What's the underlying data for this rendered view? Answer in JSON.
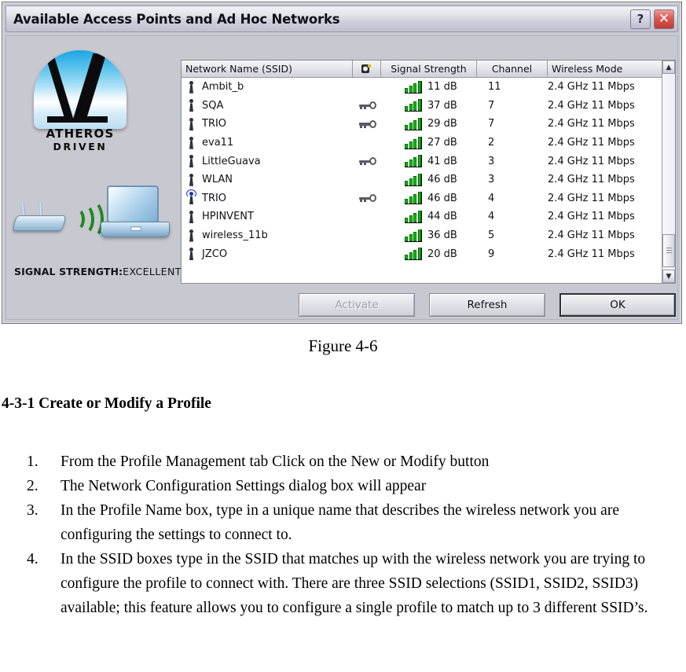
{
  "dialog": {
    "title": "Available Access Points and Ad Hoc Networks",
    "help_button": "?",
    "close_button": "✕"
  },
  "brand": {
    "logo_name": "Atheros",
    "wordmark": "ATHEROS",
    "sub_wordmark": "DRIVEN",
    "signal_label": "SIGNAL STRENGTH:",
    "signal_value": "EXCELLENT"
  },
  "network_list": {
    "columns": {
      "ssid": "Network Name (SSID)",
      "secure": "",
      "signal": "Signal Strength",
      "channel": "Channel",
      "mode": "Wireless Mode"
    },
    "rows": [
      {
        "ssid": "Ambit_b",
        "secured": false,
        "connected": false,
        "signal": "11 dB",
        "channel": "11",
        "mode": "2.4 GHz 11 Mbps"
      },
      {
        "ssid": "SQA",
        "secured": true,
        "connected": false,
        "signal": "37 dB",
        "channel": "7",
        "mode": "2.4 GHz 11 Mbps"
      },
      {
        "ssid": "TRIO",
        "secured": true,
        "connected": false,
        "signal": "29 dB",
        "channel": "7",
        "mode": "2.4 GHz 11 Mbps"
      },
      {
        "ssid": "eva11",
        "secured": false,
        "connected": false,
        "signal": "27 dB",
        "channel": "2",
        "mode": "2.4 GHz 11 Mbps"
      },
      {
        "ssid": "LittleGuava",
        "secured": true,
        "connected": false,
        "signal": "41 dB",
        "channel": "3",
        "mode": "2.4 GHz 11 Mbps"
      },
      {
        "ssid": "WLAN",
        "secured": false,
        "connected": false,
        "signal": "46 dB",
        "channel": "3",
        "mode": "2.4 GHz 11 Mbps"
      },
      {
        "ssid": "TRIO",
        "secured": true,
        "connected": true,
        "signal": "46 dB",
        "channel": "4",
        "mode": "2.4 GHz 11 Mbps"
      },
      {
        "ssid": "HPINVENT",
        "secured": false,
        "connected": false,
        "signal": "44 dB",
        "channel": "4",
        "mode": "2.4 GHz 11 Mbps"
      },
      {
        "ssid": "wireless_11b",
        "secured": false,
        "connected": false,
        "signal": "36 dB",
        "channel": "5",
        "mode": "2.4 GHz 11 Mbps"
      },
      {
        "ssid": "JZCO",
        "secured": false,
        "connected": false,
        "signal": "20 dB",
        "channel": "9",
        "mode": "2.4 GHz 11 Mbps"
      }
    ],
    "scrollbar": {
      "up_arrow": "▲",
      "down_arrow": "▼"
    }
  },
  "buttons": {
    "activate": "Activate",
    "refresh": "Refresh",
    "ok": "OK"
  },
  "document": {
    "figure_caption": "Figure 4-6",
    "section_heading": "4-3-1 Create or Modify a Profile",
    "steps": [
      {
        "num": "1.",
        "text": "From the Profile Management tab Click on the New or Modify button"
      },
      {
        "num": "2.",
        "text": "The Network Configuration Settings dialog box will appear"
      },
      {
        "num": "3.",
        "text": "In the Profile Name box, type in a unique name that describes the wireless network you are configuring the settings to connect to."
      },
      {
        "num": "4.",
        "text": "In the SSID boxes type in the SSID that matches up with the wireless network you are trying to configure the profile to connect with.  There are three SSID selections (SSID1, SSID2, SSID3) available; this feature allows you to configure a single profile to match up to 3 different SSID’s."
      }
    ]
  },
  "colors": {
    "signal_bar_green": "#00c000",
    "close_button_red": "#c23a30",
    "connected_blue": "#1b2fd0",
    "dialog_face": "#c8c8d0"
  }
}
